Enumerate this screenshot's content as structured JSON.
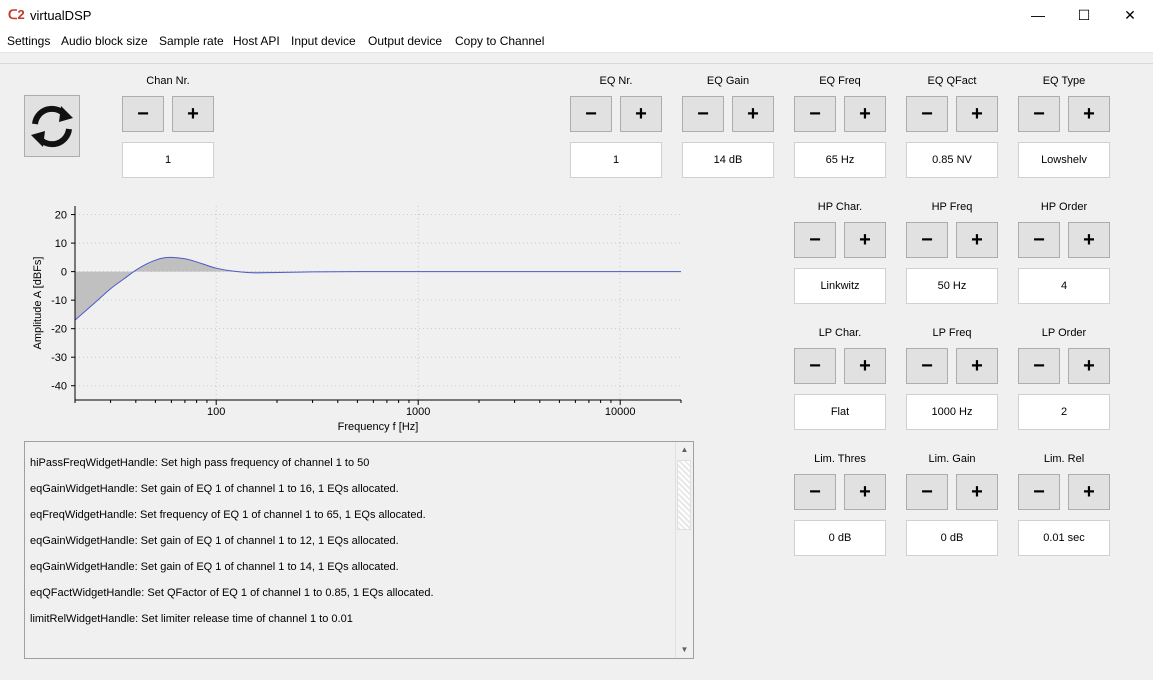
{
  "window": {
    "app_icon": "ᑕ2",
    "title": "virtualDSP",
    "minimize": "—",
    "maximize": "☐",
    "close": "✕"
  },
  "menu": [
    "Settings",
    "Audio block size",
    "Sample rate",
    "Host API",
    "Input device",
    "Output device",
    "Copy to Channel"
  ],
  "buttons": {
    "minus": "−",
    "plus": "+",
    "refresh_icon": "refresh-icon"
  },
  "controls": {
    "chan_nr": {
      "label": "Chan Nr.",
      "value": "1"
    },
    "eq_nr": {
      "label": "EQ Nr.",
      "value": "1"
    },
    "eq_gain": {
      "label": "EQ Gain",
      "value": "14 dB"
    },
    "eq_freq": {
      "label": "EQ Freq",
      "value": "65 Hz"
    },
    "eq_qfact": {
      "label": "EQ QFact",
      "value": "0.85 NV"
    },
    "eq_type": {
      "label": "EQ Type",
      "value": "Lowshelv"
    },
    "hp_char": {
      "label": "HP Char.",
      "value": "Linkwitz"
    },
    "hp_freq": {
      "label": "HP Freq",
      "value": "50 Hz"
    },
    "hp_order": {
      "label": "HP Order",
      "value": "4"
    },
    "lp_char": {
      "label": "LP Char.",
      "value": "Flat"
    },
    "lp_freq": {
      "label": "LP Freq",
      "value": "1000 Hz"
    },
    "lp_order": {
      "label": "LP Order",
      "value": "2"
    },
    "lim_thres": {
      "label": "Lim. Thres",
      "value": "0 dB"
    },
    "lim_gain": {
      "label": "Lim. Gain",
      "value": "0 dB"
    },
    "lim_rel": {
      "label": "Lim. Rel",
      "value": "0.01 sec"
    }
  },
  "chart_data": {
    "type": "line",
    "xlabel": "Frequency f [Hz]",
    "ylabel": "Amplitude A [dBFs]",
    "x_scale": "log",
    "xlim": [
      20,
      20000
    ],
    "ylim": [
      -45,
      23
    ],
    "x_ticks": [
      100,
      1000,
      10000
    ],
    "y_ticks": [
      20,
      10,
      0,
      -10,
      -20,
      -30,
      -40
    ],
    "grid": true,
    "line_color": "#4a5ac8",
    "fill_color": "#c0c0c0",
    "series": [
      {
        "x": [
          20,
          25,
          30,
          35,
          40,
          45,
          50,
          55,
          60,
          70,
          80,
          90,
          100,
          120,
          150,
          200,
          300,
          500,
          1000,
          2000,
          5000,
          10000,
          20000
        ],
        "y": [
          -17,
          -11,
          -6,
          -2.5,
          0.5,
          2.6,
          4.0,
          4.8,
          5.0,
          4.5,
          3.4,
          2.2,
          1.2,
          0.2,
          -0.4,
          -0.3,
          -0.1,
          0,
          0,
          0,
          0,
          0,
          0
        ]
      }
    ]
  },
  "log": [
    "hiPassFreqWidgetHandle: Set high pass frequency of channel 1 to 50",
    "eqGainWidgetHandle: Set gain of EQ 1 of channel 1 to 16, 1 EQs allocated.",
    "eqFreqWidgetHandle: Set frequency of EQ 1 of channel 1 to 65, 1 EQs allocated.",
    "eqGainWidgetHandle: Set gain of EQ 1 of channel 1 to 12, 1 EQs allocated.",
    "eqGainWidgetHandle: Set gain of EQ 1 of channel 1 to 14, 1 EQs allocated.",
    "eqQFactWidgetHandle: Set QFactor of EQ 1 of channel 1 to 0.85, 1 EQs allocated.",
    "limitRelWidgetHandle: Set limiter release time of channel 1 to 0.01"
  ]
}
